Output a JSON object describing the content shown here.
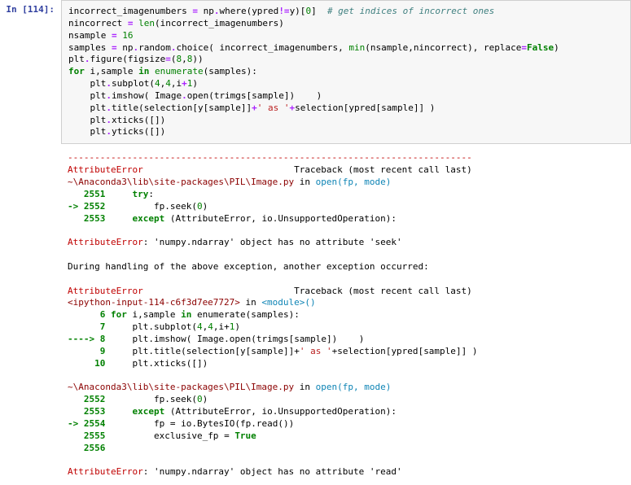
{
  "prompt": "In [114]:",
  "code": {
    "l1a": "incorrect_imagenumbers ",
    "l1b": "=",
    "l1c": " np",
    "l1d": ".",
    "l1e": "where(ypred",
    "l1f": "!=",
    "l1g": "y)[",
    "l1h": "0",
    "l1i": "]  ",
    "l1j": "# get indices of incorrect ones",
    "l2a": "nincorrect ",
    "l2b": "=",
    "l2c": " ",
    "l2d": "len",
    "l2e": "(incorrect_imagenumbers)",
    "l3a": "nsample ",
    "l3b": "=",
    "l3c": " ",
    "l3d": "16",
    "l4a": "samples ",
    "l4b": "=",
    "l4c": " np",
    "l4d": ".",
    "l4e": "random",
    "l4f": ".",
    "l4g": "choice( incorrect_imagenumbers, ",
    "l4h": "min",
    "l4i": "(nsample,nincorrect), replace",
    "l4j": "=",
    "l4k": "False",
    "l4l": ")",
    "l5a": "plt",
    "l5b": ".",
    "l5c": "figure(figsize",
    "l5d": "=",
    "l5e": "(",
    "l5f": "8",
    "l5g": ",",
    "l5h": "8",
    "l5i": "))",
    "l6a": "for",
    "l6b": " i,sample ",
    "l6c": "in",
    "l6d": " ",
    "l6e": "enumerate",
    "l6f": "(samples):",
    "l7a": "    plt",
    "l7b": ".",
    "l7c": "subplot(",
    "l7d": "4",
    "l7e": ",",
    "l7f": "4",
    "l7g": ",i",
    "l7h": "+",
    "l7i": "1",
    "l7j": ")",
    "l8a": "    plt",
    "l8b": ".",
    "l8c": "imshow( Image",
    "l8d": ".",
    "l8e": "open(trimgs[sample])    )",
    "l9a": "    plt",
    "l9b": ".",
    "l9c": "title(selection[y[sample]]",
    "l9d": "+",
    "l9e": "' as '",
    "l9f": "+",
    "l9g": "selection[ypred[sample]] )",
    "l10a": "    plt",
    "l10b": ".",
    "l10c": "xticks([])",
    "l11a": "    plt",
    "l11b": ".",
    "l11c": "yticks([])"
  },
  "out": {
    "dash": "---------------------------------------------------------------------------",
    "err1a": "AttributeError",
    "err1b": "                            Traceback (most recent call last)",
    "file1a": "~\\Anaconda3\\lib\\site-packages\\PIL\\Image.py",
    "file1b": " in ",
    "file1c": "open",
    "file1d": "(fp, mode)",
    "n2551": "   2551",
    "t2551a": "     ",
    "t2551b": "try",
    "t2551c": ":",
    "arrow2552": "-> 2552",
    "t2552a": "         fp",
    "t2552b": ".",
    "t2552c": "seek",
    "t2552d": "(",
    "t2552e": "0",
    "t2552f": ")",
    "n2553": "   2553",
    "t2553a": "     ",
    "t2553b": "except",
    "t2553c": " ",
    "t2553d": "(",
    "t2553e": "AttributeError",
    "t2553f": ",",
    "t2553g": " io",
    "t2553h": ".",
    "t2553i": "UnsupportedOperation",
    "t2553j": ")",
    "t2553k": ":",
    "msg1a": "AttributeError",
    "msg1b": ": 'numpy.ndarray' object has no attribute 'seek'",
    "during": "During handling of the above exception, another exception occurred:",
    "err2a": "AttributeError",
    "err2b": "                            Traceback (most recent call last)",
    "file2a": "<ipython-input-114-c6f3d7ee7727>",
    "file2b": " in ",
    "file2c": "<module>",
    "file2d": "()",
    "n6": "      6",
    "t6a": " ",
    "t6b": "for",
    "t6c": " i",
    "t6d": ",",
    "t6e": "sample ",
    "t6f": "in",
    "t6g": " enumerate",
    "t6h": "(",
    "t6i": "samples",
    "t6j": ")",
    "t6k": ":",
    "n7": "      7",
    "t7a": "     plt",
    "t7b": ".",
    "t7c": "subplot",
    "t7d": "(",
    "t7e": "4",
    "t7f": ",",
    "t7g": "4",
    "t7h": ",",
    "t7i": "i",
    "t7j": "+",
    "t7k": "1",
    "t7l": ")",
    "arrow8": "----> 8",
    "t8a": "     plt",
    "t8b": ".",
    "t8c": "imshow",
    "t8d": "(",
    "t8e": " Image",
    "t8f": ".",
    "t8g": "open",
    "t8h": "(",
    "t8i": "trimgs",
    "t8j": "[",
    "t8k": "sample",
    "t8l": "]",
    "t8m": ")",
    "t8n": "    ",
    "t8o": ")",
    "n9": "      9",
    "t9a": "     plt",
    "t9b": ".",
    "t9c": "title",
    "t9d": "(",
    "t9e": "selection",
    "t9f": "[",
    "t9g": "y",
    "t9h": "[",
    "t9i": "sample",
    "t9j": "]",
    "t9k": "]",
    "t9l": "+",
    "t9m": "' as '",
    "t9n": "+",
    "t9o": "selection",
    "t9p": "[",
    "t9q": "ypred",
    "t9r": "[",
    "t9s": "sample",
    "t9t": "]",
    "t9u": "]",
    "t9v": " ",
    "t9w": ")",
    "n10": "     10",
    "t10a": "     plt",
    "t10b": ".",
    "t10c": "xticks",
    "t10d": "(",
    "t10e": "[",
    "t10f": "]",
    "t10g": ")",
    "file3a": "~\\Anaconda3\\lib\\site-packages\\PIL\\Image.py",
    "file3b": " in ",
    "file3c": "open",
    "file3d": "(fp, mode)",
    "bn2552": "   2552",
    "bt2552a": "         fp",
    "bt2552b": ".",
    "bt2552c": "seek",
    "bt2552d": "(",
    "bt2552e": "0",
    "bt2552f": ")",
    "bn2553": "   2553",
    "bt2553a": "     ",
    "bt2553b": "except",
    "bt2553c": " ",
    "bt2553d": "(",
    "bt2553e": "AttributeError",
    "bt2553f": ",",
    "bt2553g": " io",
    "bt2553h": ".",
    "bt2553i": "UnsupportedOperation",
    "bt2553j": ")",
    "bt2553k": ":",
    "arrow2554": "-> 2554",
    "bt2554a": "         fp ",
    "bt2554b": "=",
    "bt2554c": " io",
    "bt2554d": ".",
    "bt2554e": "BytesIO",
    "bt2554f": "(",
    "bt2554g": "fp",
    "bt2554h": ".",
    "bt2554i": "read",
    "bt2554j": "(",
    "bt2554k": ")",
    "bt2554l": ")",
    "bn2555": "   2555",
    "bt2555a": "         exclusive_fp ",
    "bt2555b": "=",
    "bt2555c": " ",
    "bt2555d": "True",
    "bn2556": "   2556",
    "msg2a": "AttributeError",
    "msg2b": ": 'numpy.ndarray' object has no attribute 'read'"
  }
}
